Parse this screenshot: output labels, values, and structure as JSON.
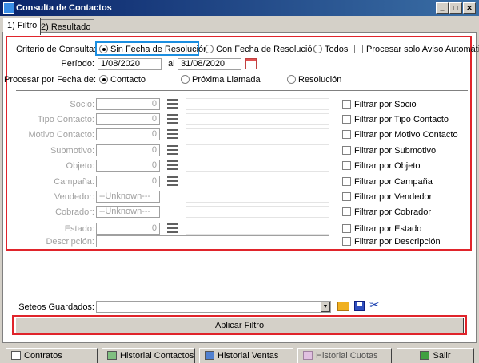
{
  "window": {
    "title": "Consulta de Contactos"
  },
  "tabs": [
    {
      "label": "1) Filtro"
    },
    {
      "label": "2) Resultado"
    }
  ],
  "criteria": {
    "label": "Criterio de Consulta:",
    "options": [
      "Sin Fecha de Resolución",
      "Con Fecha de Resolución",
      "Todos"
    ],
    "selected": "Sin Fecha de Resolución",
    "auto_check_label": "Procesar solo Aviso Automático"
  },
  "period": {
    "label": "Período:",
    "from": "1/08/2020",
    "to_label": "al",
    "to": "31/08/2020"
  },
  "process_by": {
    "label": "Procesar por Fecha de:",
    "options": [
      "Contacto",
      "Próxima Llamada",
      "Resolución"
    ],
    "selected": "Contacto"
  },
  "filters": [
    {
      "label": "Socio:",
      "value": "0",
      "check_label": "Filtrar por Socio"
    },
    {
      "label": "Tipo Contacto:",
      "value": "0",
      "check_label": "Filtrar por Tipo Contacto"
    },
    {
      "label": "Motivo Contacto:",
      "value": "0",
      "check_label": "Filtrar por Motivo Contacto"
    },
    {
      "label": "Submotivo:",
      "value": "0",
      "check_label": "Filtrar por Submotivo"
    },
    {
      "label": "Objeto:",
      "value": "0",
      "check_label": "Filtrar por Objeto"
    },
    {
      "label": "Campaña:",
      "value": "0",
      "check_label": "Filtrar por Campaña"
    },
    {
      "label": "Vendedor:",
      "value": "--Unknown---",
      "check_label": "Filtrar por Vendedor"
    },
    {
      "label": "Cobrador:",
      "value": "--Unknown---",
      "check_label": "Filtrar por Cobrador"
    },
    {
      "label": "Estado:",
      "value": "0",
      "check_label": "Filtrar por Estado"
    },
    {
      "label": "Descripción:",
      "value": "",
      "check_label": "Filtrar por Descripción"
    }
  ],
  "saved": {
    "label": "Seteos Guardados:",
    "value": ""
  },
  "apply_button": "Aplicar Filtro",
  "bottom_buttons": [
    {
      "label": "Contratos",
      "icon": "contracts-icon"
    },
    {
      "label": "Historial Contactos",
      "icon": "history-contacts-icon"
    },
    {
      "label": "Historial Ventas",
      "icon": "history-sales-icon"
    },
    {
      "label": "Historial Cuotas",
      "icon": "history-fees-icon"
    },
    {
      "label": "Salir",
      "icon": "exit-icon"
    }
  ]
}
